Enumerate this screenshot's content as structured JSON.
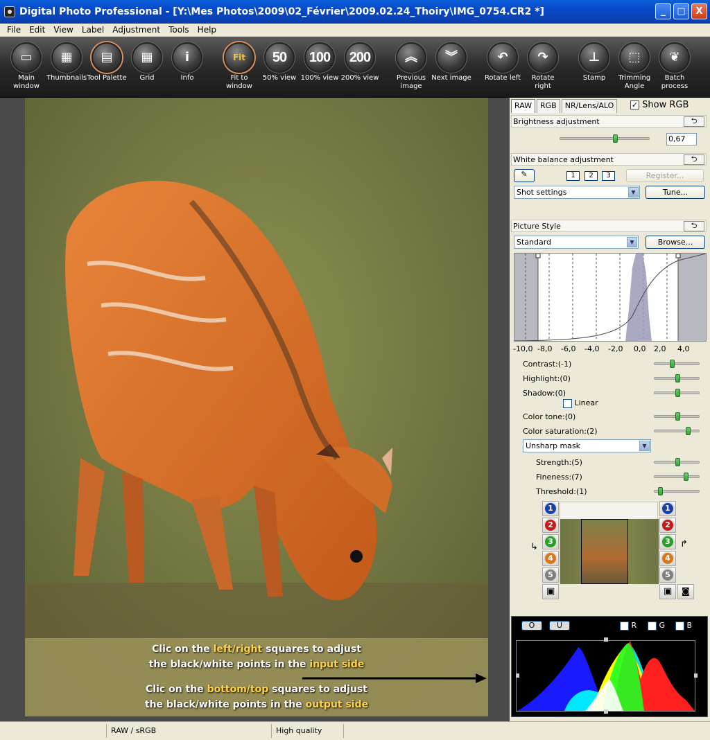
{
  "window": {
    "title": "Digital Photo Professional - [Y:\\Mes Photos\\2009\\02_Février\\2009.02.24_Thoiry\\IMG_0754.CR2 *]",
    "controls": [
      "_",
      "□",
      "X"
    ]
  },
  "menu": [
    "File",
    "Edit",
    "View",
    "Label",
    "Adjustment",
    "Tools",
    "Help"
  ],
  "toolbar": {
    "main_window": "Main window",
    "thumbnails": "Thumbnails",
    "tool_palette": "Tool Palette",
    "grid": "Grid",
    "info": "Info",
    "fit_to_window": "Fit to window",
    "fit_glyph": "Fit",
    "view50": "50% view",
    "view50_glyph": "50",
    "view100": "100% view",
    "view100_glyph": "100",
    "view200": "200% view",
    "view200_glyph": "200",
    "previous_image": "Previous image",
    "next_image": "Next image",
    "rotate_left": "Rotate left",
    "rotate_right": "Rotate right",
    "stamp": "Stamp",
    "trimming_angle": "Trimming Angle",
    "batch_process": "Batch process"
  },
  "photo": {
    "annotation_input_1a": "Clic on the ",
    "annotation_input_1b": "left/right",
    "annotation_input_1c": " squares to adjust",
    "annotation_input_2a": "the black/white points in the ",
    "annotation_input_2b": "input side",
    "annotation_output_1a": "Clic on the ",
    "annotation_output_1b": "bottom/top",
    "annotation_output_1c": " squares to adjust",
    "annotation_output_2a": "the black/white points in the ",
    "annotation_output_2b": "output side"
  },
  "panel": {
    "tabs": [
      "RAW",
      "RGB",
      "NR/Lens/ALO"
    ],
    "show_rgb": "Show RGB",
    "show_rgb_checked": true,
    "brightness": {
      "header": "Brightness adjustment",
      "value": "0,67",
      "level": 0.67
    },
    "white_balance": {
      "header": "White balance adjustment",
      "presets": [
        "1",
        "2",
        "3"
      ],
      "register": "Register...",
      "shot_settings": "Shot settings",
      "tune": "Tune..."
    },
    "picture_style": {
      "header": "Picture Style",
      "style": "Standard",
      "browse": "Browse...",
      "axis_ticks": [
        "-10,0",
        "-8,0",
        "-6,0",
        "-4,0",
        "-2,0",
        "0,0",
        "2,0",
        "4,0"
      ],
      "contrast": "Contrast:(-1)",
      "highlight": "Highlight:(0)",
      "shadow": "Shadow:(0)",
      "linear": "Linear",
      "color_tone": "Color tone:(0)",
      "color_saturation": "Color saturation:(2)",
      "unsharp_mask": "Unsharp mask",
      "strength": "Strength:(5)",
      "fineness": "Fineness:(7)",
      "threshold": "Threshold:(1)"
    },
    "snapshots": {
      "left": [
        "1",
        "2",
        "3",
        "4",
        "5"
      ],
      "right": [
        "1",
        "2",
        "3",
        "4",
        "5"
      ],
      "colors": [
        "#1a3fa8",
        "#c81818",
        "#28a028",
        "#d87818",
        "#808080"
      ]
    },
    "histogram": {
      "o_button": "O",
      "u_button": "U",
      "r": "R",
      "g": "G",
      "b": "B"
    }
  },
  "status": {
    "cell1": "",
    "color_space": "RAW / sRGB",
    "quality": "High quality"
  }
}
